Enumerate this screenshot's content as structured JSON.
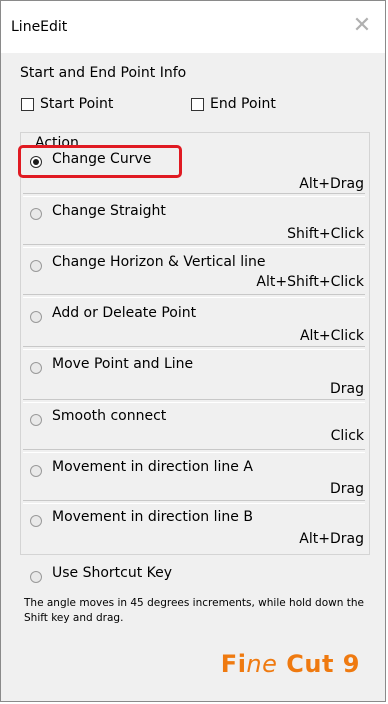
{
  "window": {
    "title": "LineEdit",
    "close_glyph": "✕"
  },
  "endpoint_info": {
    "heading": "Start and End Point Info",
    "start_point_label": "Start Point",
    "end_point_label": "End Point",
    "start_point_checked": false,
    "end_point_checked": false
  },
  "action": {
    "legend": "Action",
    "options": [
      {
        "label": "Change Curve",
        "shortcut": "Alt+Drag",
        "selected": true
      },
      {
        "label": "Change Straight",
        "shortcut": "Shift+Click",
        "selected": false
      },
      {
        "label": "Change Horizon & Vertical line",
        "shortcut": "Alt+Shift+Click",
        "selected": false
      },
      {
        "label": "Add or Deleate Point",
        "shortcut": "Alt+Click",
        "selected": false
      },
      {
        "label": "Move Point and Line",
        "shortcut": "Drag",
        "selected": false
      },
      {
        "label": "Smooth connect",
        "shortcut": "Click",
        "selected": false
      },
      {
        "label": "Movement in direction line A",
        "shortcut": "Drag",
        "selected": false
      },
      {
        "label": "Movement in direction line B",
        "shortcut": "Alt+Drag",
        "selected": false
      }
    ]
  },
  "shortcut_key": {
    "label": "Use Shortcut Key",
    "selected": false
  },
  "note": "The angle moves in 45 degrees increments, while hold down the Shift key and drag.",
  "brand": {
    "logo_text": "FineCut9",
    "color": "#ef7a10"
  },
  "colors": {
    "highlight": "#e01a22",
    "panel_bg": "#f0f0f0"
  }
}
